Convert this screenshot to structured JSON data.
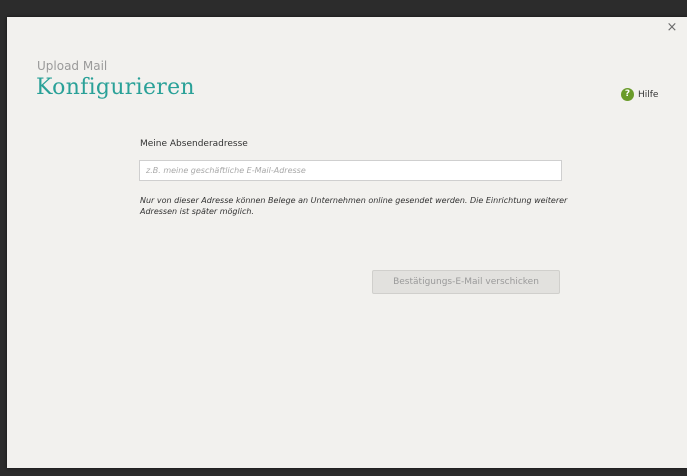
{
  "dialog": {
    "close_icon": "×",
    "subtitle": "Upload Mail",
    "title": "Konfigurieren",
    "help": {
      "icon": "?",
      "label": "Hilfe"
    }
  },
  "form": {
    "sender_label": "Meine Absenderadresse",
    "sender_value": "",
    "sender_placeholder": "z.B. meine geschäftliche E-Mail-Adresse",
    "note": "Nur von dieser Adresse können Belege an Unternehmen online gesendet werden. Die Einrichtung weiterer Adressen ist später möglich.",
    "send_button_label": "Bestätigungs-E-Mail verschicken"
  },
  "colors": {
    "accent": "#2aa198",
    "help_icon": "#6a9b2a",
    "background": "#f2f1ee"
  }
}
